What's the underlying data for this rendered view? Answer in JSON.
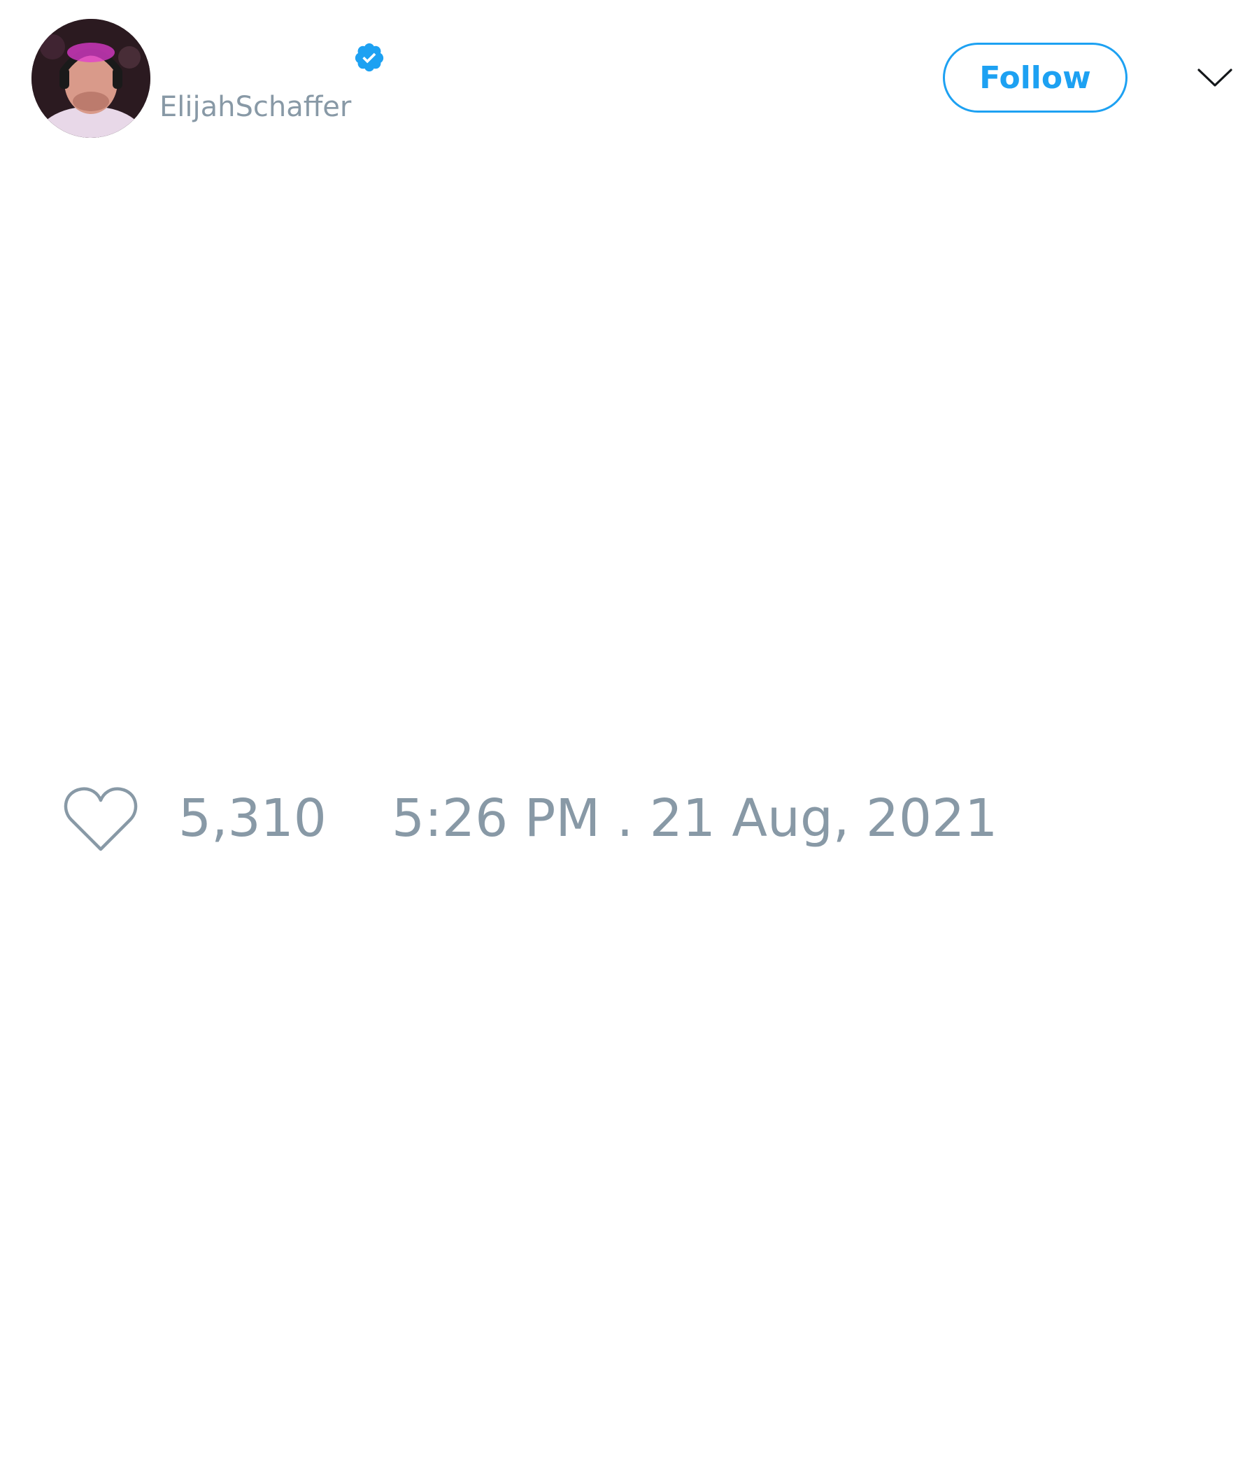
{
  "author": {
    "handle": "ElijahSchaffer",
    "verified": true
  },
  "header": {
    "follow_label": "Follow"
  },
  "engagement": {
    "likes": "5,310"
  },
  "meta": {
    "timestamp": "5:26 PM . 21 Aug, 2021"
  },
  "icons": {
    "verified": "verified-badge-icon",
    "menu": "chevron-down-icon",
    "like": "heart-outline-icon"
  },
  "colors": {
    "accent": "#1da1f2",
    "muted_text": "#8899a6",
    "background": "#ffffff"
  }
}
